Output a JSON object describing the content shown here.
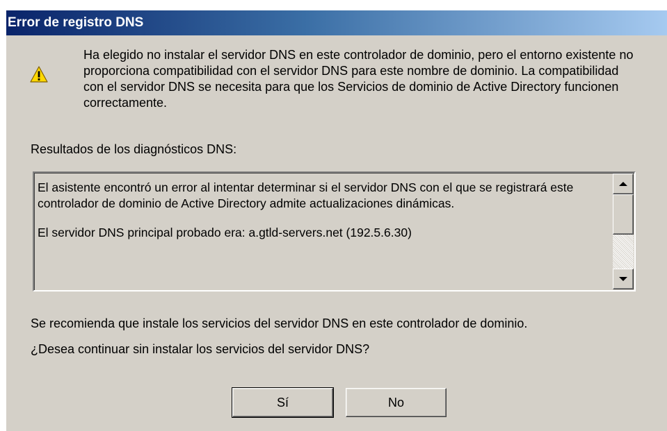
{
  "dialog": {
    "title": "Error de registro DNS",
    "icon": "warning-icon",
    "message": "Ha elegido no instalar el servidor DNS en este controlador de dominio, pero el entorno existente no proporciona compatibilidad con el servidor DNS para este nombre de dominio. La compatibilidad con el servidor DNS se necesita para que los Servicios de dominio de Active Directory funcionen correctamente.",
    "diagnostics_label": "Resultados de los diagnósticos DNS:",
    "diagnostics": {
      "paragraph1": "El asistente encontró un error al intentar determinar si el servidor DNS con el que se registrará este controlador de dominio de Active Directory admite actualizaciones dinámicas.",
      "paragraph2": "El servidor DNS principal probado era: a.gtld-servers.net (192.5.6.30)"
    },
    "recommendation": "Se recomienda que instale los servicios del servidor DNS en este controlador de dominio.",
    "question": "¿Desea continuar sin instalar los servicios del servidor DNS?",
    "buttons": {
      "yes_label": "Sí",
      "no_label": "No"
    }
  },
  "colors": {
    "title_gradient_start": "#0a246a",
    "title_gradient_end": "#a6caf0",
    "dialog_background": "#d4d0c8",
    "warning_yellow": "#ffd800"
  }
}
